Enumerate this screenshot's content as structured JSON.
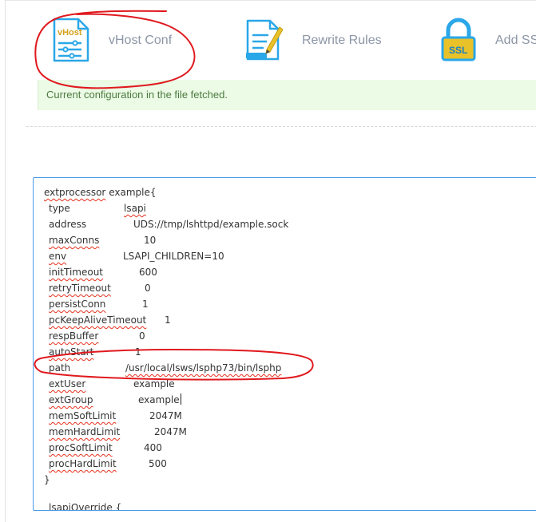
{
  "toolbar": {
    "vhost_conf": {
      "label": "vHost Conf",
      "icon_text": "vHost",
      "icon": "vhost-document-icon"
    },
    "rewrite_rules": {
      "label": "Rewrite Rules",
      "icon": "edit-document-icon"
    },
    "add_ssl": {
      "label": "Add SS",
      "icon_text": "SSL",
      "icon": "ssl-lock-icon"
    }
  },
  "alert": {
    "message": "Current configuration in the file fetched."
  },
  "editor": {
    "open_line": {
      "keyword": "extprocessor",
      "name": "example{"
    },
    "entries": [
      {
        "key": "type",
        "value": "lsapi"
      },
      {
        "key": "address",
        "value": "UDS://tmp/lshttpd/example.sock"
      },
      {
        "key": "maxConns",
        "value": "10"
      },
      {
        "key": "env",
        "value": "LSAPI_CHILDREN=10"
      },
      {
        "key": "initTimeout",
        "value": "600"
      },
      {
        "key": "retryTimeout",
        "value": "0"
      },
      {
        "key": "persistConn",
        "value": "1"
      },
      {
        "key": "pcKeepAliveTimeout",
        "value": "1"
      },
      {
        "key": "respBuffer",
        "value": "0"
      },
      {
        "key": "autoStart",
        "value": "1"
      },
      {
        "key": "path",
        "value": "/usr/local/lsws/lsphp73/bin/lsphp"
      },
      {
        "key": "extUser",
        "value": "example"
      },
      {
        "key": "extGroup",
        "value": "example"
      },
      {
        "key": "memSoftLimit",
        "value": "2047M"
      },
      {
        "key": "memHardLimit",
        "value": "2047M"
      },
      {
        "key": "procSoftLimit",
        "value": "400"
      },
      {
        "key": "procHardLimit",
        "value": "500"
      }
    ],
    "close_line": "}",
    "next_line_partial": "lsapiOverride {"
  },
  "colors": {
    "annotation": "#e0191e",
    "alert_bg": "#ebfbe6",
    "alert_text": "#4d7a3e",
    "editor_border": "#4a9be8",
    "toolbar_label": "#8c96a6",
    "icon_blue": "#2aa7e8",
    "icon_yellow": "#e9c22a"
  }
}
